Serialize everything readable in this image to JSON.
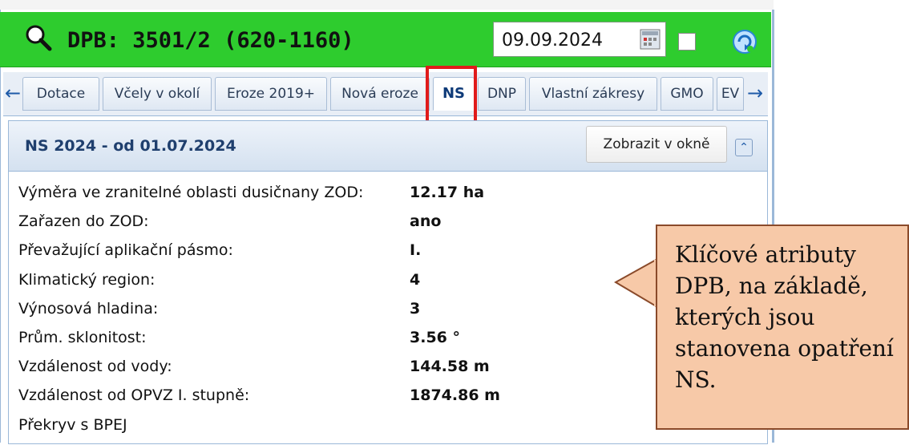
{
  "title": "DPB: 3501/2 (620-1160)",
  "date": "09.09.2024",
  "icons": {
    "search": "search-icon",
    "calendar": "calendar-icon",
    "refresh": "refresh-icon",
    "prev": "arrow-left-icon",
    "next": "arrow-right-icon",
    "collapse": "collapse-up-icon"
  },
  "tabs": [
    {
      "label": "Dotace"
    },
    {
      "label": "Včely v okolí"
    },
    {
      "label": "Eroze 2019+"
    },
    {
      "label": "Nová eroze"
    },
    {
      "label": "NS",
      "active": true
    },
    {
      "label": "DNP"
    },
    {
      "label": "Vlastní zákresy"
    },
    {
      "label": "GMO"
    },
    {
      "label": "EV"
    }
  ],
  "section": {
    "title": "NS 2024 - od 01.07.2024",
    "show_window": "Zobrazit v okně"
  },
  "attributes": [
    {
      "label": "Výměra ve zranitelné oblasti dusičnany ZOD:",
      "value": "12.17 ha"
    },
    {
      "label": "Zařazen do ZOD:",
      "value": "ano"
    },
    {
      "label": "Převažující aplikační pásmo:",
      "value": "I."
    },
    {
      "label": "Klimatický region:",
      "value": "4"
    },
    {
      "label": "Výnosová hladina:",
      "value": "3"
    },
    {
      "label": "Prům. sklonitost:",
      "value": "3.56 °"
    },
    {
      "label": "Vzdálenost od vody:",
      "value": "144.58 m"
    },
    {
      "label": "Vzdálenost od OPVZ I. stupně:",
      "value": "1874.86 m"
    },
    {
      "label": "Překryv s BPEJ",
      "value": ""
    }
  ],
  "callout": {
    "text": "Klíčové atributy DPB, na základě, kterých jsou stanovena opatření NS."
  },
  "colors": {
    "titlebar": "#2ecc2e",
    "highlight": "#e01b1b",
    "callout": "#f7c9a8"
  }
}
